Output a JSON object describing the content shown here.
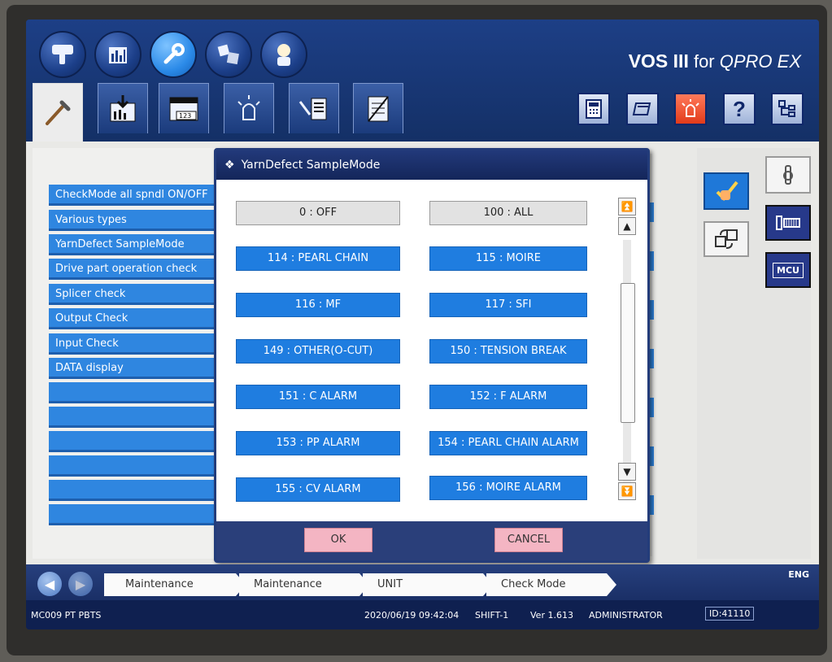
{
  "header": {
    "brand_bold": "VOS III",
    "brand_rest": " for ",
    "brand_italic": "QPRO EX",
    "top_buttons": [
      "hand-pointer-icon",
      "bar-chart-icon",
      "wrench-icon",
      "cubes-icon",
      "operator-icon"
    ],
    "tabs": [
      "wrench-tab-icon",
      "download-tab-icon",
      "calendar-tab-icon",
      "alarm-lamp-tab-icon",
      "maintenance-list-tab-icon",
      "cancel-doc-tab-icon"
    ],
    "help_label": "?"
  },
  "menu": {
    "items": [
      "CheckMode all spndl ON/OFF",
      "Various types",
      "YarnDefect SampleMode",
      "Drive part operation check",
      "Splicer check",
      "Output Check",
      "Input Check",
      "DATA display"
    ]
  },
  "dialog": {
    "title": "YarnDefect SampleMode",
    "options": [
      {
        "label": "0 : OFF",
        "style": "plain"
      },
      {
        "label": "100 : ALL",
        "style": "plain"
      },
      {
        "label": "114 : PEARL CHAIN",
        "style": "blue"
      },
      {
        "label": "115 : MOIRE",
        "style": "blue"
      },
      {
        "label": "116 : MF",
        "style": "blue"
      },
      {
        "label": "117 : SFI",
        "style": "blue"
      },
      {
        "label": "149 : OTHER(O-CUT)",
        "style": "blue"
      },
      {
        "label": "150 : TENSION BREAK",
        "style": "blue"
      },
      {
        "label": "151 : C ALARM",
        "style": "blue"
      },
      {
        "label": "152 : F ALARM",
        "style": "blue"
      },
      {
        "label": "153 : PP ALARM",
        "style": "blue"
      },
      {
        "label": "154 : PEARL CHAIN ALARM",
        "style": "blue"
      },
      {
        "label": "155 : CV ALARM",
        "style": "blue"
      },
      {
        "label": "156 : MOIRE ALARM",
        "style": "blue"
      }
    ],
    "ok_label": "OK",
    "cancel_label": "CANCEL"
  },
  "breadcrumb": {
    "items": [
      "Maintenance",
      "Maintenance",
      "UNIT",
      "Check Mode"
    ]
  },
  "status": {
    "lang": "ENG",
    "machine": "MC009 PT PBTS",
    "datetime": "2020/06/19 09:42:04",
    "shift": "SHIFT-1",
    "version": "Ver 1.613",
    "user": "ADMINISTRATOR",
    "id": "ID:41110"
  },
  "side": {
    "mcu_label": "MCU"
  },
  "colors": {
    "accent_blue": "#1f7de0",
    "header_navy": "#1d3f86",
    "alert_red": "#e23b1a",
    "button_pink": "#f4b5c3"
  }
}
